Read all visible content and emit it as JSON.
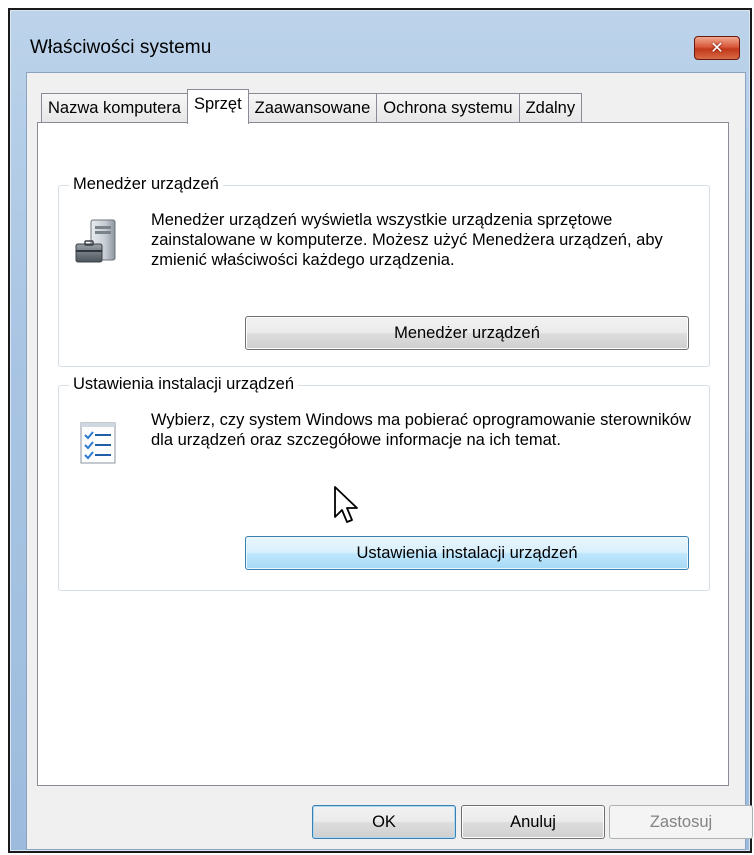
{
  "window": {
    "title": "Właściwości systemu",
    "close_glyph": "✕"
  },
  "tabs": [
    {
      "label": "Nazwa komputera",
      "active": false
    },
    {
      "label": "Sprzęt",
      "active": true
    },
    {
      "label": "Zaawansowane",
      "active": false
    },
    {
      "label": "Ochrona systemu",
      "active": false
    },
    {
      "label": "Zdalny",
      "active": false
    }
  ],
  "device_manager": {
    "group_label": "Menedżer urządzeń",
    "description": "Menedżer urządzeń wyświetla wszystkie urządzenia sprzętowe zainstalowane w komputerze. Możesz użyć Menedżera urządzeń, aby zmienić właściwości każdego urządzenia.",
    "button_label": "Menedżer urządzeń",
    "icon": "device-manager-icon"
  },
  "device_installation": {
    "group_label": "Ustawienia instalacji urządzeń",
    "description": "Wybierz, czy system Windows ma pobierać oprogramowanie sterowników dla urządzeń oraz szczegółowe informacje na ich temat.",
    "button_label": "Ustawienia instalacji urządzeń",
    "icon": "checklist-icon"
  },
  "footer": {
    "ok_label": "OK",
    "cancel_label": "Anuluj",
    "apply_label": "Zastosuj"
  },
  "colors": {
    "title_bar": "#a9c5e3",
    "close_button": "#c2381a",
    "hover_button": "#bee6fd"
  }
}
